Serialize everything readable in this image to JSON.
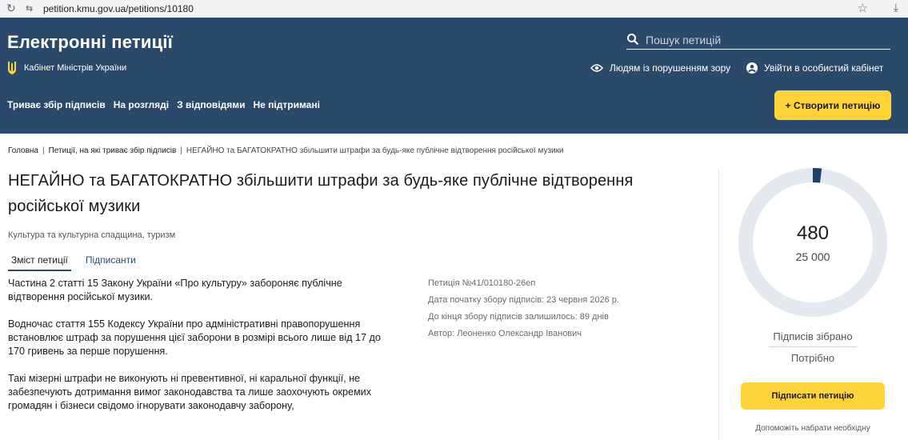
{
  "browser": {
    "url": "petition.kmu.gov.ua/petitions/10180",
    "site_info": "⇆"
  },
  "header": {
    "title": "Електронні петиції",
    "org": "Кабінет Міністрів України",
    "search_placeholder": "Пошук петицій",
    "accessibility": "Людям із порушенням зору",
    "login": "Увійти в особистий кабінет",
    "nav": [
      "Триває збір підписів",
      "На розгляді",
      "З відповідями",
      "Не підтримані"
    ],
    "create_button": "+ Створити петицію"
  },
  "breadcrumb": {
    "home": "Головна",
    "section": "Петиції, на які триває збір підписів",
    "current": "НЕГАЙНО та БАГАТОКРАТНО збільшити штрафи за будь-яке публічне відтворення російської музики",
    "separator": "|"
  },
  "petition": {
    "title": "НЕГАЙНО та БАГАТОКРАТНО збільшити штрафи за будь-яке публічне відтворення російської музики",
    "category": "Культура та культурна спадщина, туризм",
    "tabs": [
      "Зміст петиції",
      "Підписанти"
    ],
    "paragraphs": [
      "Частина 2 статті 15 Закону України «Про культуру» забороняє публічне відтворення російської музики.",
      "Водночас стаття 155 Кодексу України про адміністративні правопорушення встановлює штраф за порушення цієї заборони в розмірі всього лише від 17 до 170 гривень за перше порушення.",
      "Такі мізерні штрафи не виконують ні превентивної, ні каральної функції, не забезпечують дотримання вимог законодавства та лише заохочують окремих громадян і бізнеси свідомо ігнорувати законодавчу заборону,"
    ],
    "meta": {
      "number": "Петиція №41/010180-26еп",
      "start_date": "Дата початку збору підписів: 23 червня 2026 р.",
      "days_left": "До кінця збору підписів залишилось: 89 днів",
      "author": "Автор: Леоненко Олександр Іванович"
    }
  },
  "signatures": {
    "collected": "480",
    "goal": "25 000",
    "progress_fraction": 0.0192,
    "collected_label": "Підписів зібрано",
    "needed_label": "Потрібно",
    "sign_button": "Підписати петицію",
    "help_text": "Допоможіть набрати необхідну"
  },
  "colors": {
    "header_bg": "#2b4a6b",
    "accent_yellow": "#ffd43b",
    "donut_track": "#e4e9f0",
    "donut_fill": "#1e3f66"
  }
}
